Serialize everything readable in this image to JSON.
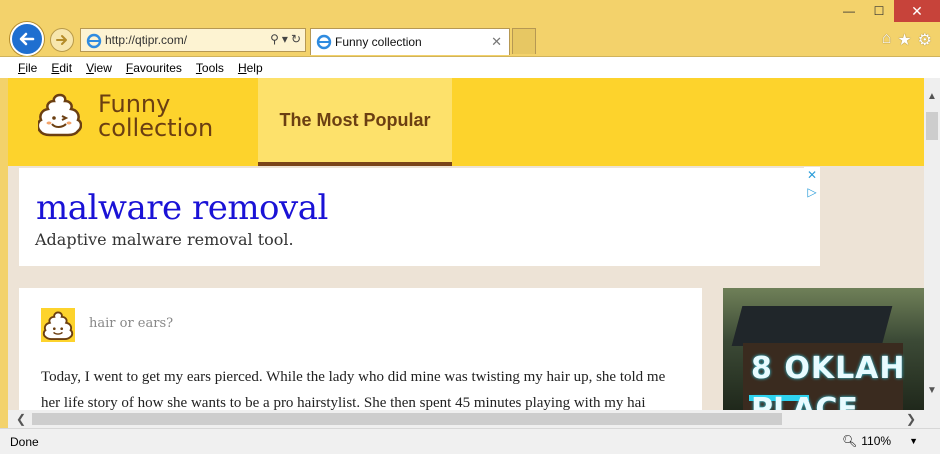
{
  "browser": {
    "url": "http://qtipr.com/",
    "tab_title": "Funny collection",
    "window_controls": {
      "minimize": "—",
      "maximize": "☐",
      "close": "✕"
    },
    "menu": [
      "File",
      "Edit",
      "View",
      "Favourites",
      "Tools",
      "Help"
    ],
    "status": "Done",
    "zoom": "110%",
    "icons": [
      "back-icon",
      "forward-icon",
      "ie-icon",
      "search-icon",
      "refresh-icon",
      "home-icon",
      "favorites-star-icon",
      "settings-gear-icon"
    ]
  },
  "site": {
    "logo_line1": "Funny",
    "logo_line2": "collection",
    "nav_active": "The Most Popular"
  },
  "ad": {
    "title": "malware removal",
    "description": "Adaptive malware removal tool."
  },
  "post": {
    "title": "hair or ears?",
    "body": "Today, I went to get my ears pierced. While the lady who did mine was twisting my hair up, she told me her life story of how she wants to be a pro hairstylist. She then spent 45 minutes playing with my hai"
  },
  "side_ad": {
    "line1": "8 OKLAH",
    "line2": "PLACE"
  },
  "colors": {
    "chrome": "#f3d26b",
    "site_header": "#fdd32c",
    "nav_active_bg": "#fde16b",
    "brand_brown": "#6b3f12",
    "ad_link": "#1a12d6"
  }
}
